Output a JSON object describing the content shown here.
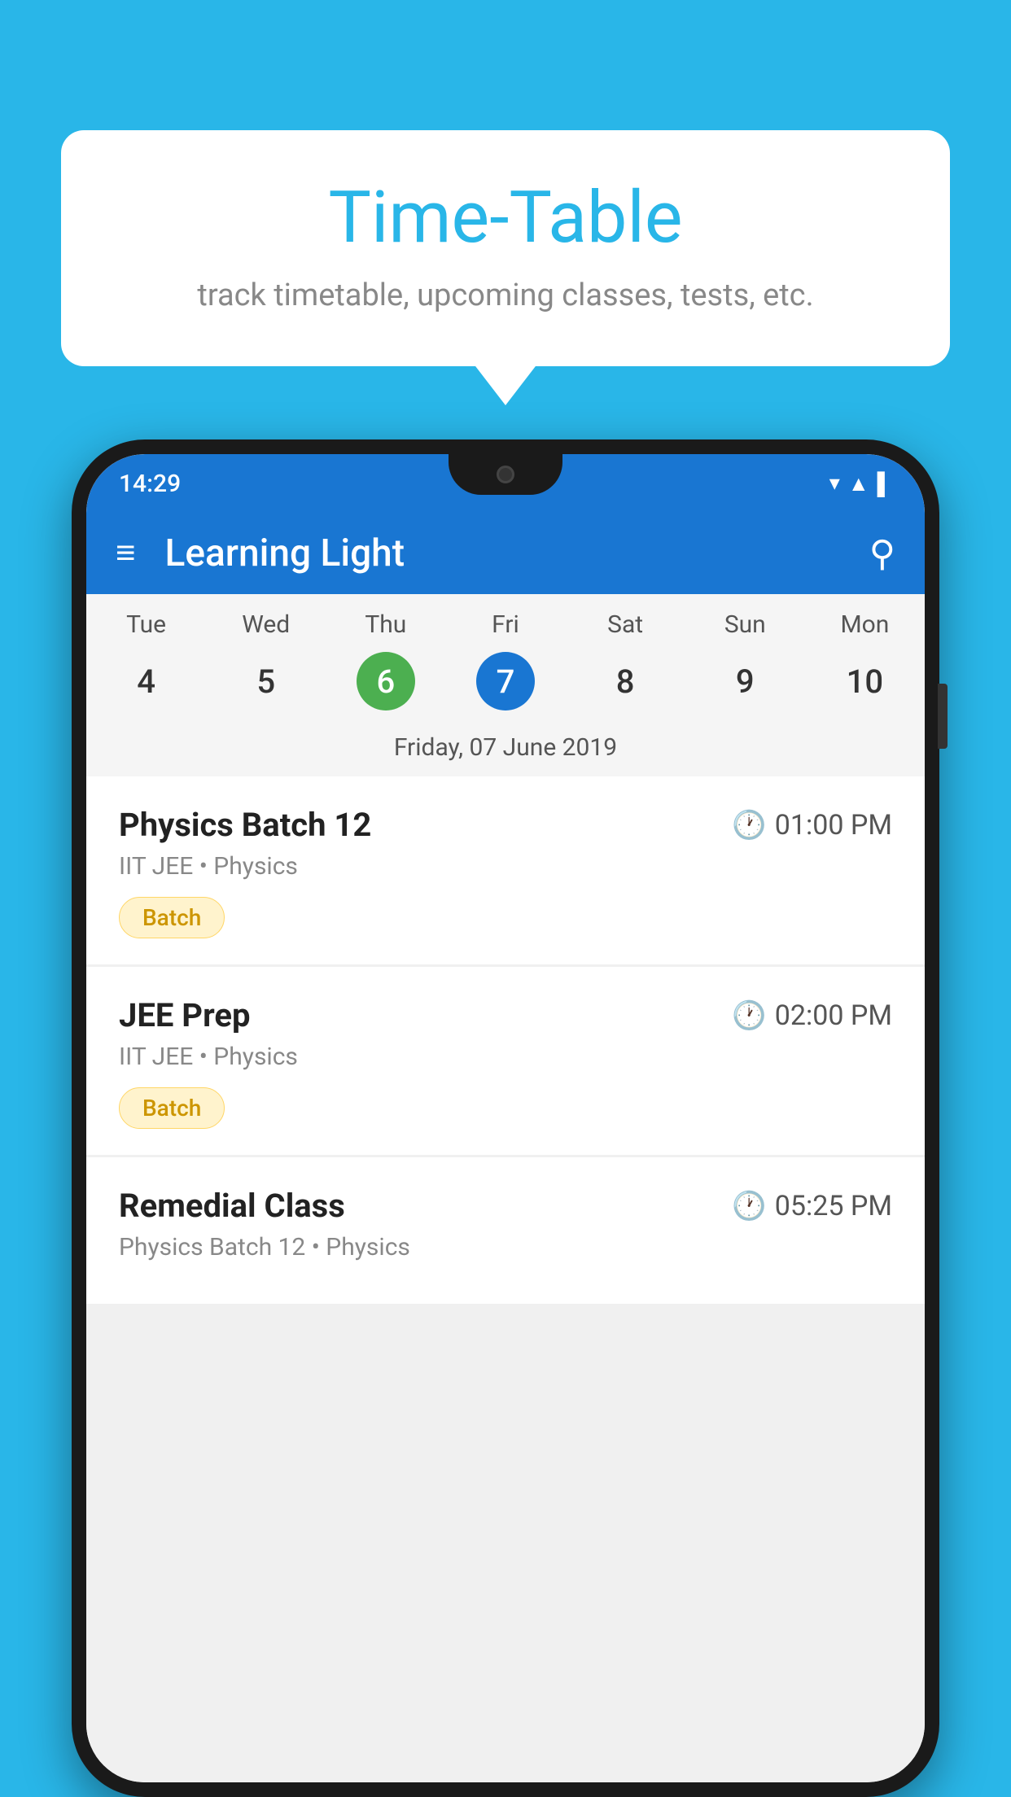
{
  "background_color": "#29b6e8",
  "speech_bubble": {
    "title": "Time-Table",
    "subtitle": "track timetable, upcoming classes, tests, etc."
  },
  "phone": {
    "status_bar": {
      "time": "14:29",
      "icons": [
        "wifi",
        "signal",
        "battery"
      ]
    },
    "app_header": {
      "title": "Learning Light",
      "menu_icon": "≡",
      "search_icon": "🔍"
    },
    "calendar": {
      "day_names": [
        "Tue",
        "Wed",
        "Thu",
        "Fri",
        "Sat",
        "Sun",
        "Mon"
      ],
      "day_numbers": [
        "4",
        "5",
        "6",
        "7",
        "8",
        "9",
        "10"
      ],
      "today_index": 2,
      "selected_index": 3,
      "selected_date_label": "Friday, 07 June 2019"
    },
    "schedule_items": [
      {
        "title": "Physics Batch 12",
        "time": "01:00 PM",
        "subtitle": "IIT JEE • Physics",
        "badge": "Batch"
      },
      {
        "title": "JEE Prep",
        "time": "02:00 PM",
        "subtitle": "IIT JEE • Physics",
        "badge": "Batch"
      },
      {
        "title": "Remedial Class",
        "time": "05:25 PM",
        "subtitle": "Physics Batch 12 • Physics",
        "badge": null
      }
    ]
  }
}
